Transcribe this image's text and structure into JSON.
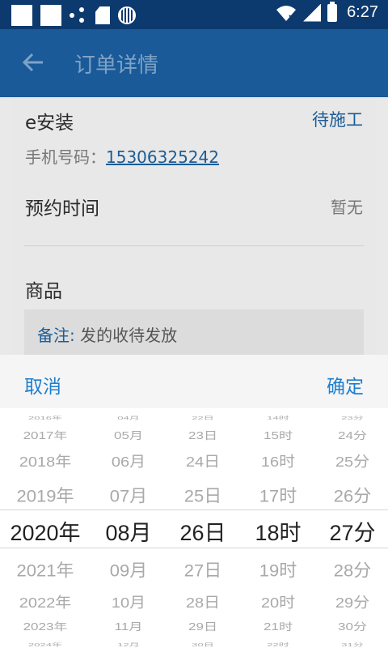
{
  "status_bar": {
    "time": "6:27"
  },
  "app_bar": {
    "title": "订单详情"
  },
  "order": {
    "name": "e安装",
    "status": "待施工",
    "phone_label": "手机号码：",
    "phone": "15306325242",
    "appointment_label": "预约时间",
    "appointment_value": "暂无",
    "goods_label": "商品",
    "note_label": "备注:",
    "note_text": "发的收待发放"
  },
  "picker": {
    "cancel": "取消",
    "confirm": "确定",
    "columns": [
      {
        "items": [
          "2016年",
          "2017年",
          "2018年",
          "2019年",
          "2020年",
          "2021年",
          "2022年",
          "2023年",
          "2024年"
        ],
        "selected": 4
      },
      {
        "items": [
          "04月",
          "05月",
          "06月",
          "07月",
          "08月",
          "09月",
          "10月",
          "11月",
          "12月"
        ],
        "selected": 4
      },
      {
        "items": [
          "22日",
          "23日",
          "24日",
          "25日",
          "26日",
          "27日",
          "28日",
          "29日",
          "30日"
        ],
        "selected": 4
      },
      {
        "items": [
          "14时",
          "15时",
          "16时",
          "17时",
          "18时",
          "19时",
          "20时",
          "21时",
          "22时"
        ],
        "selected": 4
      },
      {
        "items": [
          "23分",
          "24分",
          "25分",
          "26分",
          "27分",
          "28分",
          "29分",
          "30分",
          "31分"
        ],
        "selected": 4
      }
    ]
  }
}
